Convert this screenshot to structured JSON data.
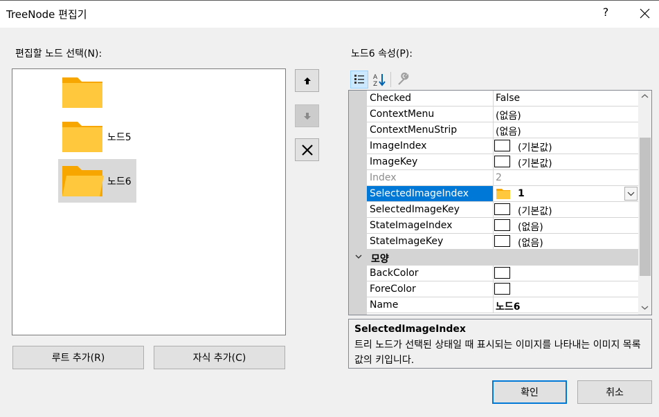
{
  "window": {
    "title": "TreeNode 편집기",
    "help_label": "?",
    "close_icon": "close-icon"
  },
  "left": {
    "tree_label": "편집할 노드 선택(N):",
    "nodes": [
      {
        "label": "",
        "icon": "folder-icon"
      },
      {
        "label": "노드5",
        "icon": "folder-icon"
      },
      {
        "label": "노드6",
        "icon": "folder-open-icon",
        "selected": true
      }
    ],
    "add_root_label": "루트 추가(R)",
    "add_child_label": "자식 추가(C)"
  },
  "side_buttons": [
    {
      "name": "move-up",
      "icon": "arrow-up-icon",
      "enabled": true
    },
    {
      "name": "move-down",
      "icon": "arrow-down-icon",
      "enabled": false
    },
    {
      "name": "delete",
      "icon": "delete-x-icon",
      "enabled": true
    }
  ],
  "properties": {
    "label": "노드6 속성(P):",
    "toolbar": [
      {
        "icon": "categorized-icon",
        "active": true
      },
      {
        "icon": "alphabetical-icon",
        "active": false
      },
      {
        "icon": "property-pages-icon",
        "active": false
      }
    ],
    "rows": [
      {
        "name": "Checked",
        "value": "False"
      },
      {
        "name": "ContextMenu",
        "value": "(없음)"
      },
      {
        "name": "ContextMenuStrip",
        "value": "(없음)"
      },
      {
        "name": "ImageIndex",
        "value": "(기본값)",
        "swatch": true
      },
      {
        "name": "ImageKey",
        "value": "(기본값)",
        "swatch": true
      },
      {
        "name": "Index",
        "value": "2",
        "disabled": true
      },
      {
        "name": "SelectedImageIndex",
        "value": "1",
        "selected": true
      },
      {
        "name": "SelectedImageKey",
        "value": "(기본값)",
        "swatch": true
      },
      {
        "name": "StateImageIndex",
        "value": "(없음)",
        "swatch": true
      },
      {
        "name": "StateImageKey",
        "value": "(없음)",
        "swatch": true
      }
    ],
    "category": {
      "name": "모양",
      "icon": "chevron-down-icon"
    },
    "rows2": [
      {
        "name": "BackColor",
        "value": "",
        "swatch": true
      },
      {
        "name": "ForeColor",
        "value": "",
        "swatch": true
      },
      {
        "name": "Name",
        "value": "노드6",
        "bold": true
      }
    ],
    "description_title": "SelectedImageIndex",
    "description_text": "트리 노드가 선택된 상태일 때 표시되는 이미지를 나타내는 이미지 목록 값의 키입니다."
  },
  "footer": {
    "ok_label": "확인",
    "cancel_label": "취소"
  },
  "colors": {
    "accent": "#0078d7",
    "folder": "#ffc83d",
    "folder_dark": "#f7a600"
  }
}
